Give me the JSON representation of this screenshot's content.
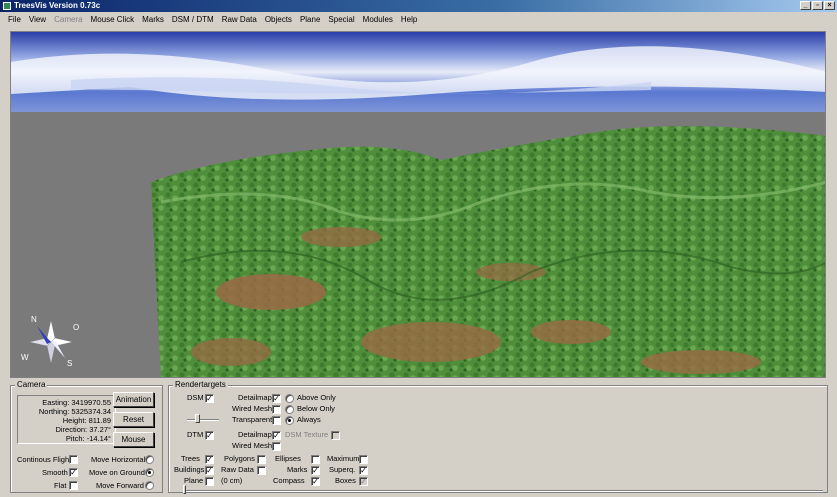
{
  "window": {
    "title": "TreesVis Version 0.73c",
    "min": "_",
    "max": "▫",
    "close": "×"
  },
  "menu": [
    {
      "label": "File",
      "enabled": true
    },
    {
      "label": "View",
      "enabled": true
    },
    {
      "label": "Camera",
      "enabled": false
    },
    {
      "label": "Mouse Click",
      "enabled": true
    },
    {
      "label": "Marks",
      "enabled": true
    },
    {
      "label": "DSM / DTM",
      "enabled": true
    },
    {
      "label": "Raw Data",
      "enabled": true
    },
    {
      "label": "Objects",
      "enabled": true
    },
    {
      "label": "Plane",
      "enabled": true
    },
    {
      "label": "Special",
      "enabled": true
    },
    {
      "label": "Modules",
      "enabled": true
    },
    {
      "label": "Help",
      "enabled": true
    }
  ],
  "compass": {
    "n": "N",
    "o": "O",
    "s": "S",
    "w": "W"
  },
  "camera": {
    "legend": "Camera",
    "easting": "Easting: 3419970.55",
    "northing": "Northing: 5325374.34",
    "height": "Height: 811.89",
    "direction": "Direction: 37.27°",
    "pitch": "Pitch: -14.14°",
    "animation_label": "Animation",
    "reset_label": "Reset",
    "mouse_label": "Mouse",
    "continuous_flight": "Continous Flight",
    "continuous_flight_checked": false,
    "smooth": "Smooth",
    "smooth_checked": true,
    "flat": "Flat",
    "flat_checked": false,
    "move_horizontal": "Move Horizontal",
    "move_on_ground": "Move on Ground",
    "move_forward": "Move Forward",
    "move_mode": "Move on Ground"
  },
  "render": {
    "legend": "Rendertargets",
    "dsm": "DSM",
    "dsm_checked": true,
    "detailmap": "Detailmap",
    "detailmap_dsm_checked": true,
    "wired_mesh": "Wired Mesh",
    "wired_mesh_dsm_checked": false,
    "transparent": "Transparent",
    "transparent_checked": false,
    "above_only": "Above Only",
    "below_only": "Below Only",
    "always": "Always",
    "visibility_mode": "Always",
    "dtm": "DTM",
    "dtm_checked": true,
    "detailmap_dtm_checked": true,
    "wired_mesh_dtm_checked": false,
    "dsm_texture": "DSM Texture",
    "dsm_texture_checked": false,
    "trees": "Trees",
    "trees_checked": true,
    "polygons": "Polygons",
    "polygons_checked": false,
    "ellipses": "Ellipses",
    "ellipses_checked": false,
    "maximum": "Maximum",
    "maximum_checked": false,
    "buildings": "Buildings",
    "buildings_checked": true,
    "raw_data": "Raw Data",
    "raw_data_checked": false,
    "marks": "Marks",
    "marks_checked": true,
    "superq": "Superq.",
    "superq_checked": true,
    "plane": "Plane",
    "plane_checked": false,
    "plane_height": "(0 cm)",
    "compass": "Compass",
    "compass_checked": true,
    "boxes": "Boxes",
    "boxes_checked": true,
    "transparency_level": 0.3,
    "plane_slider_level": 0.0
  },
  "colors": {
    "accent": "#0a246a",
    "terrain_green": "#4e8c3a",
    "soil": "#9a6a44",
    "ground": "#7a7a7a"
  }
}
